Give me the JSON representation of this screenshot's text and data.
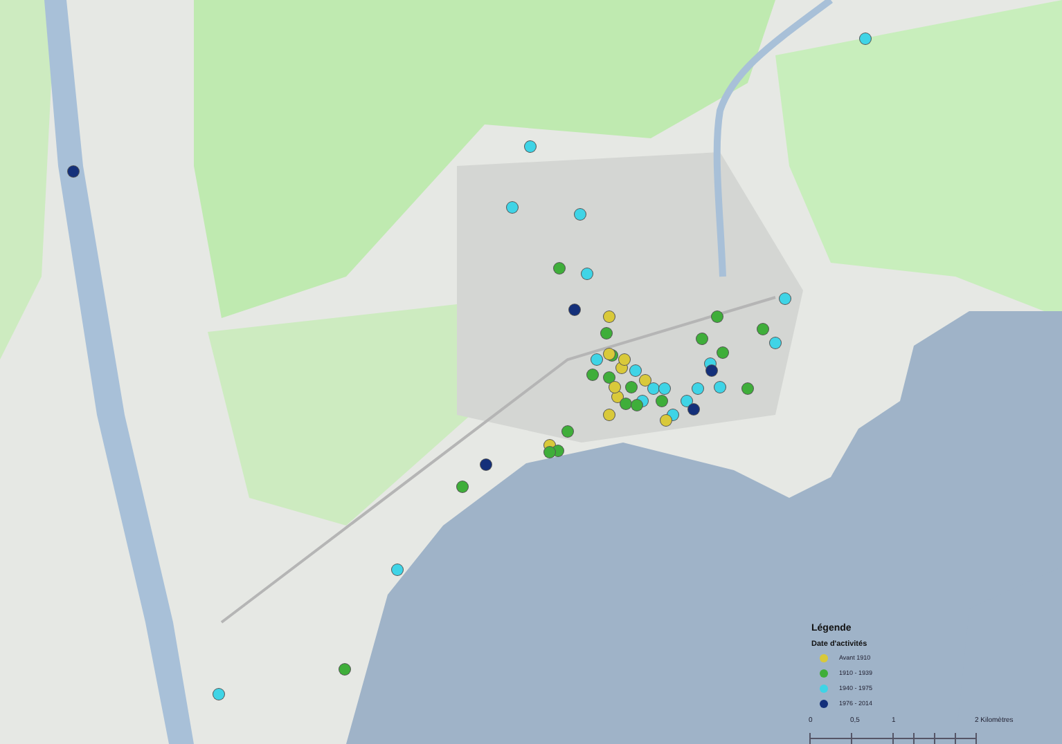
{
  "legend": {
    "title": "Légende",
    "subtitle": "Date d'activités",
    "items": [
      {
        "label": "Avant 1910",
        "color": "#d9c93a"
      },
      {
        "label": "1910 - 1939",
        "color": "#3fae3a"
      },
      {
        "label": "1940 - 1975",
        "color": "#3fd4e6"
      },
      {
        "label": "1976 - 2014",
        "color": "#14307a"
      }
    ]
  },
  "scale_bar": {
    "labels": [
      "0",
      "0,5",
      "1",
      "2 Kilomètres"
    ]
  },
  "sites": [
    {
      "color": "#3fd4e6"
    },
    {
      "color": "#14307a"
    },
    {
      "color": "#3fd4e6"
    },
    {
      "color": "#3fd4e6"
    },
    {
      "color": "#3fd4e6"
    },
    {
      "color": "#3fae3a"
    },
    {
      "color": "#3fd4e6"
    },
    {
      "color": "#14307a"
    },
    {
      "color": "#3fae3a"
    },
    {
      "color": "#3fd4e6"
    },
    {
      "color": "#3fae3a"
    },
    {
      "color": "#3fd4e6"
    },
    {
      "color": "#d9c93a"
    },
    {
      "color": "#3fae3a"
    },
    {
      "color": "#3fae3a"
    },
    {
      "color": "#3fd4e6"
    },
    {
      "color": "#d9c93a"
    },
    {
      "color": "#3fd4e6"
    },
    {
      "color": "#d9c93a"
    },
    {
      "color": "#3fae3a"
    },
    {
      "color": "#3fae3a"
    },
    {
      "color": "#d9c93a"
    },
    {
      "color": "#3fae3a"
    },
    {
      "color": "#3fd4e6"
    },
    {
      "color": "#3fd4e6"
    },
    {
      "color": "#3fd4e6"
    },
    {
      "color": "#3fae3a"
    },
    {
      "color": "#3fd4e6"
    },
    {
      "color": "#3fd4e6"
    },
    {
      "color": "#3fd4e6"
    },
    {
      "color": "#3fae3a"
    },
    {
      "color": "#3fd4e6"
    },
    {
      "color": "#3fae3a"
    },
    {
      "color": "#14307a"
    },
    {
      "color": "#3fd4e6"
    },
    {
      "color": "#3fae3a"
    },
    {
      "color": "#14307a"
    },
    {
      "color": "#d9c93a"
    },
    {
      "color": "#d9c93a"
    },
    {
      "color": "#3fae3a"
    },
    {
      "color": "#3fae3a"
    },
    {
      "color": "#d9c93a"
    },
    {
      "color": "#3fae3a"
    },
    {
      "color": "#3fae3a"
    },
    {
      "color": "#14307a"
    },
    {
      "color": "#3fae3a"
    },
    {
      "color": "#3fd4e6"
    },
    {
      "color": "#3fae3a"
    },
    {
      "color": "#3fd4e6"
    },
    {
      "color": "#d9c93a"
    },
    {
      "color": "#d9c93a"
    },
    {
      "color": "#3fae3a"
    },
    {
      "color": "#d9c93a"
    }
  ]
}
